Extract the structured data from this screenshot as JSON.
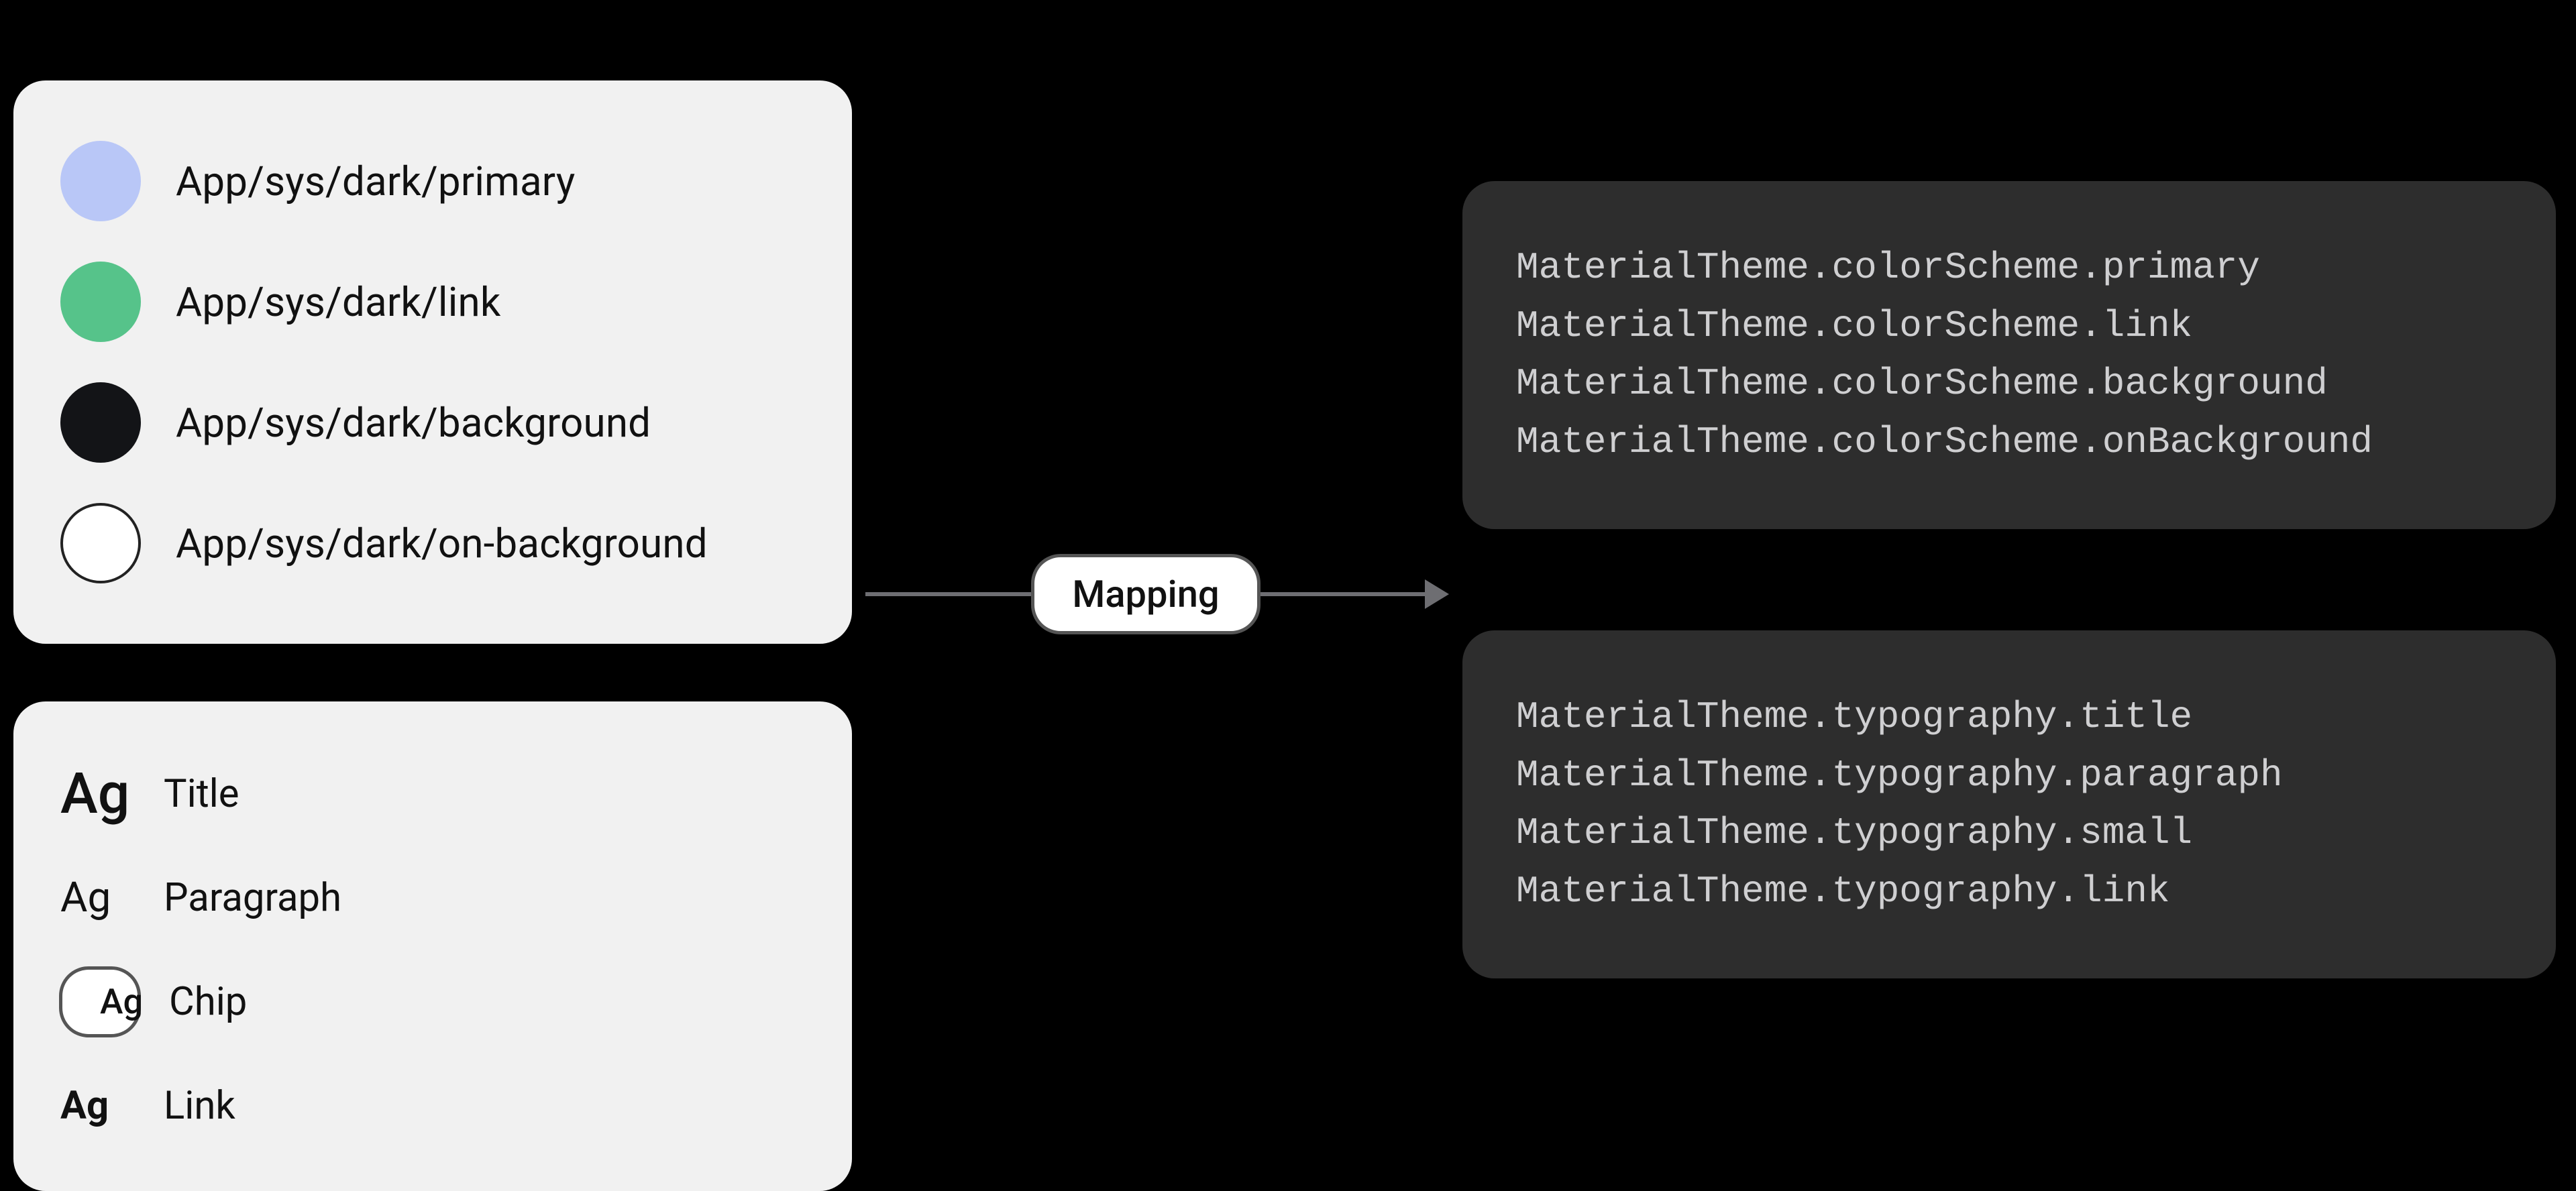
{
  "connector": {
    "label": "Mapping"
  },
  "colors": {
    "items": [
      {
        "label": "App/sys/dark/primary",
        "hex": "#b9c7f7"
      },
      {
        "label": "App/sys/dark/link",
        "hex": "#56c38a"
      },
      {
        "label": "App/sys/dark/background",
        "hex": "#131417"
      },
      {
        "label": "App/sys/dark/on-background",
        "hex": "#ffffff"
      }
    ]
  },
  "typography": {
    "glyph": "Ag",
    "items": [
      {
        "name": "Title",
        "style": "title"
      },
      {
        "name": "Paragraph",
        "style": "para"
      },
      {
        "name": "Chip",
        "style": "chip"
      },
      {
        "name": "Link",
        "style": "link"
      }
    ]
  },
  "code": {
    "colors": [
      "MaterialTheme.colorScheme.primary",
      "MaterialTheme.colorScheme.link",
      "MaterialTheme.colorScheme.background",
      "MaterialTheme.colorScheme.onBackground"
    ],
    "typography": [
      "MaterialTheme.typography.title",
      "MaterialTheme.typography.paragraph",
      "MaterialTheme.typography.small",
      "MaterialTheme.typography.link"
    ]
  }
}
